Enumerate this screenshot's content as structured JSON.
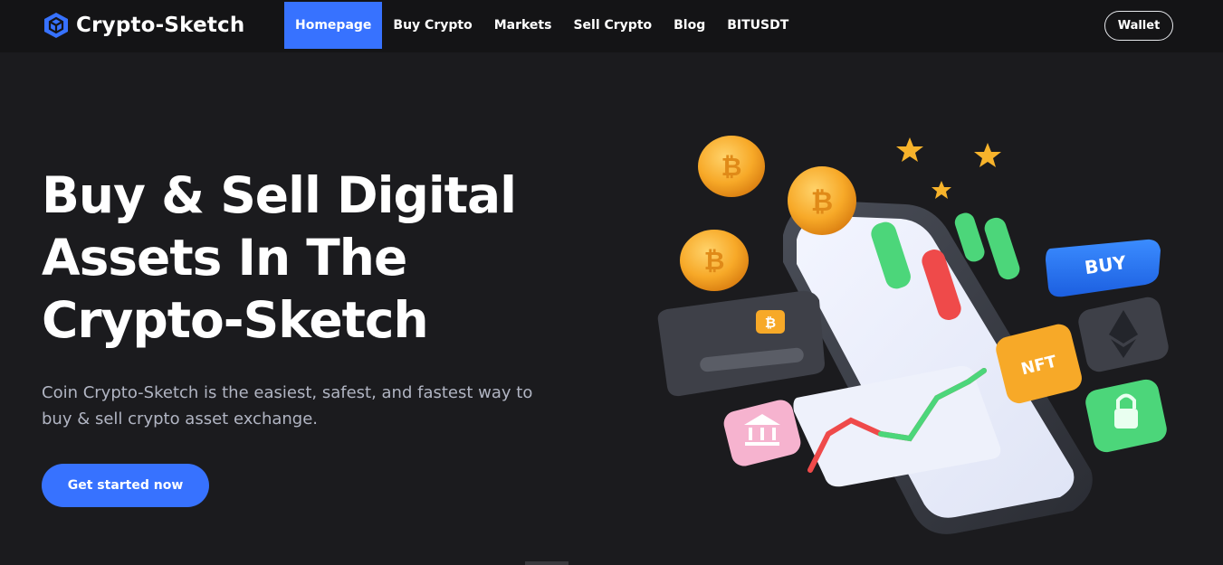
{
  "header": {
    "brand_name": "Crypto-Sketch",
    "brand_icon": "cube-logo-icon",
    "nav": [
      {
        "label": "Homepage",
        "active": true
      },
      {
        "label": "Buy Crypto",
        "active": false
      },
      {
        "label": "Markets",
        "active": false
      },
      {
        "label": "Sell Crypto",
        "active": false
      },
      {
        "label": "Blog",
        "active": false
      },
      {
        "label": "BITUSDT",
        "active": false
      }
    ],
    "wallet_label": "Wallet"
  },
  "hero": {
    "title_line1": "Buy & Sell Digital",
    "title_line2": "Assets In The",
    "title_line3": "Crypto-Sketch",
    "subtitle": "Coin Crypto-Sketch is the easiest, safest, and fastest way to buy & sell crypto asset exchange.",
    "cta_label": "Get started now"
  },
  "illustration": {
    "buy_tile_text": "BUY",
    "nft_tile_text": "NFT",
    "icons": [
      "bitcoin-coin-icon",
      "star-icon",
      "ethereum-icon",
      "lock-icon",
      "bank-icon",
      "credit-card-icon",
      "candlestick-icon"
    ]
  },
  "colors": {
    "accent": "#3772ff",
    "background": "#1b1b1e",
    "navbar": "#141416",
    "subtitle_text": "#b1b5c3"
  }
}
